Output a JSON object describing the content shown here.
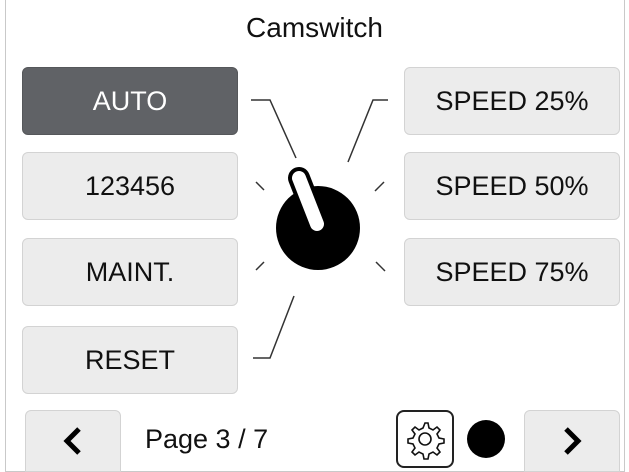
{
  "title": "Camswitch",
  "left_buttons": [
    {
      "label": "AUTO",
      "active": true
    },
    {
      "label": "123456",
      "active": false
    },
    {
      "label": "MAINT.",
      "active": false
    },
    {
      "label": "RESET",
      "active": false
    }
  ],
  "right_buttons": [
    {
      "label": "SPEED 25%"
    },
    {
      "label": "SPEED 50%"
    },
    {
      "label": "SPEED 75%"
    }
  ],
  "footer": {
    "page_label": "Page 3 / 7",
    "prev_icon": "chevron-left-icon",
    "next_icon": "chevron-right-icon",
    "settings_icon": "gear-icon"
  },
  "colors": {
    "active_button": "#606266",
    "button": "#ececec",
    "knob": "#000000"
  }
}
